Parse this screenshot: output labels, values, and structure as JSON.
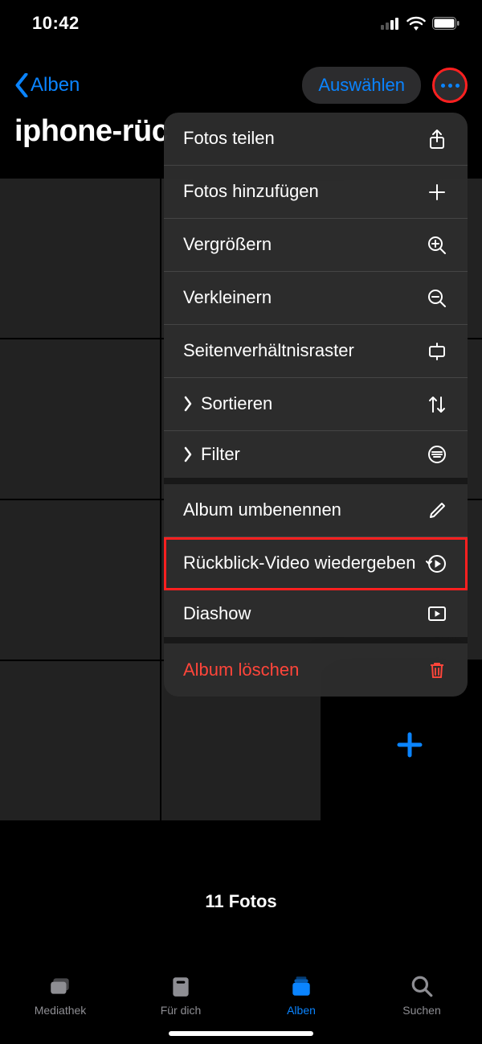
{
  "status": {
    "time": "10:42"
  },
  "nav": {
    "back_label": "Alben",
    "select_label": "Auswählen"
  },
  "album": {
    "title": "iphone-rüc",
    "count_label": "11 Fotos"
  },
  "menu": {
    "items": [
      {
        "label": "Fotos teilen",
        "icon": "share-icon",
        "chevron": false,
        "danger": false,
        "sep": false,
        "highlight": false
      },
      {
        "label": "Fotos hinzufügen",
        "icon": "plus-icon",
        "chevron": false,
        "danger": false,
        "sep": false,
        "highlight": false
      },
      {
        "label": "Vergrößern",
        "icon": "zoom-in-icon",
        "chevron": false,
        "danger": false,
        "sep": false,
        "highlight": false
      },
      {
        "label": "Verkleinern",
        "icon": "zoom-out-icon",
        "chevron": false,
        "danger": false,
        "sep": false,
        "highlight": false
      },
      {
        "label": "Seitenverhältnisraster",
        "icon": "aspect-grid-icon",
        "chevron": false,
        "danger": false,
        "sep": false,
        "highlight": false
      },
      {
        "label": "Sortieren",
        "icon": "sort-icon",
        "chevron": true,
        "danger": false,
        "sep": false,
        "highlight": false
      },
      {
        "label": "Filter",
        "icon": "filter-icon",
        "chevron": true,
        "danger": false,
        "sep": true,
        "highlight": false
      },
      {
        "label": "Album umbenennen",
        "icon": "pencil-icon",
        "chevron": false,
        "danger": false,
        "sep": false,
        "highlight": false
      },
      {
        "label": "Rückblick-Video wiedergeben",
        "icon": "memory-play-icon",
        "chevron": false,
        "danger": false,
        "sep": false,
        "highlight": true
      },
      {
        "label": "Diashow",
        "icon": "slideshow-icon",
        "chevron": false,
        "danger": false,
        "sep": true,
        "highlight": false
      },
      {
        "label": "Album löschen",
        "icon": "trash-icon",
        "chevron": false,
        "danger": true,
        "sep": false,
        "highlight": false
      }
    ]
  },
  "tabs": [
    {
      "label": "Mediathek",
      "icon": "library-icon",
      "active": false
    },
    {
      "label": "Für dich",
      "icon": "for-you-icon",
      "active": false
    },
    {
      "label": "Alben",
      "icon": "albums-icon",
      "active": true
    },
    {
      "label": "Suchen",
      "icon": "search-icon",
      "active": false
    }
  ],
  "colors": {
    "accent": "#0a84ff",
    "danger": "#ff453a",
    "highlight": "#ff2020"
  }
}
